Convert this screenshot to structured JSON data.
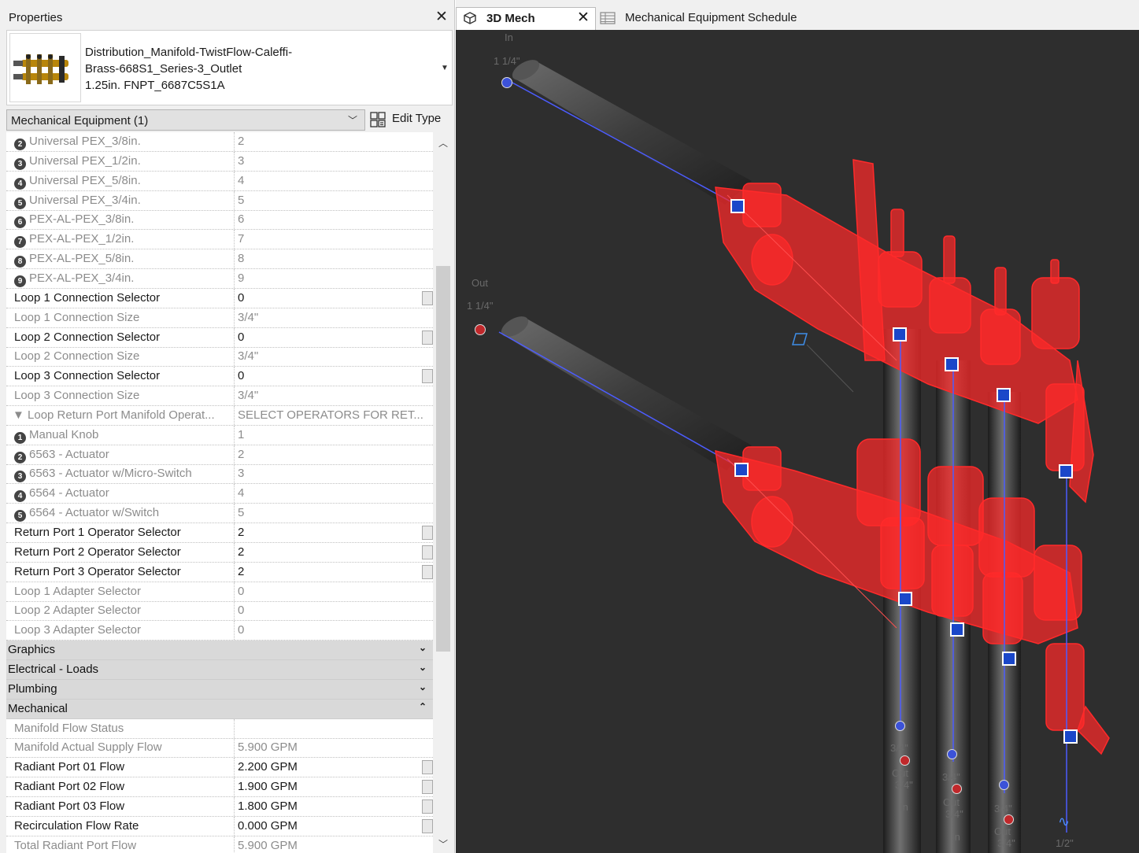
{
  "properties_panel": {
    "title": "Properties",
    "type_selector": {
      "name": "Distribution_Manifold-TwistFlow-Caleffi-\nBrass-668S1_Series-3_Outlet\n1.25in. FNPT_6687C5S1A",
      "thumbnail_icon": "manifold-thumbnail"
    },
    "filter": {
      "selected": "Mechanical Equipment (1)"
    },
    "edit_type_label": "Edit Type",
    "rows": [
      {
        "kind": "item",
        "num": "2",
        "name": "Universal PEX_3/8in.",
        "value": "2",
        "readonly": true
      },
      {
        "kind": "item",
        "num": "3",
        "name": "Universal PEX_1/2in.",
        "value": "3",
        "readonly": true
      },
      {
        "kind": "item",
        "num": "4",
        "name": "Universal PEX_5/8in.",
        "value": "4",
        "readonly": true
      },
      {
        "kind": "item",
        "num": "5",
        "name": "Universal PEX_3/4in.",
        "value": "5",
        "readonly": true
      },
      {
        "kind": "item",
        "num": "6",
        "name": "PEX-AL-PEX_3/8in.",
        "value": "6",
        "readonly": true
      },
      {
        "kind": "item",
        "num": "7",
        "name": "PEX-AL-PEX_1/2in.",
        "value": "7",
        "readonly": true
      },
      {
        "kind": "item",
        "num": "8",
        "name": "PEX-AL-PEX_5/8in.",
        "value": "8",
        "readonly": true
      },
      {
        "kind": "item",
        "num": "9",
        "name": "PEX-AL-PEX_3/4in.",
        "value": "9",
        "readonly": true
      },
      {
        "kind": "param",
        "name": "Loop 1 Connection Selector",
        "value": "0",
        "readonly": false
      },
      {
        "kind": "param",
        "name": "Loop 1 Connection Size",
        "value": "3/4\"",
        "readonly": true
      },
      {
        "kind": "param",
        "name": "Loop 2 Connection Selector",
        "value": "0",
        "readonly": false
      },
      {
        "kind": "param",
        "name": "Loop 2 Connection Size",
        "value": "3/4\"",
        "readonly": true
      },
      {
        "kind": "param",
        "name": "Loop 3 Connection Selector",
        "value": "0",
        "readonly": false
      },
      {
        "kind": "param",
        "name": "Loop 3 Connection Size",
        "value": "3/4\"",
        "readonly": true
      },
      {
        "kind": "subheader",
        "name": "▼ Loop Return Port Manifold Operat...",
        "value": "SELECT OPERATORS FOR RET...",
        "readonly": true
      },
      {
        "kind": "item",
        "num": "1",
        "name": "Manual Knob",
        "value": "1",
        "readonly": true
      },
      {
        "kind": "item",
        "num": "2",
        "name": "6563 - Actuator",
        "value": "2",
        "readonly": true
      },
      {
        "kind": "item",
        "num": "3",
        "name": "6563 - Actuator w/Micro-Switch",
        "value": "3",
        "readonly": true
      },
      {
        "kind": "item",
        "num": "4",
        "name": "6564 - Actuator",
        "value": "4",
        "readonly": true
      },
      {
        "kind": "item",
        "num": "5",
        "name": "6564 - Actuator w/Switch",
        "value": "5",
        "readonly": true
      },
      {
        "kind": "param",
        "name": "Return Port 1 Operator Selector",
        "value": "2",
        "readonly": false
      },
      {
        "kind": "param",
        "name": "Return Port 2 Operator Selector",
        "value": "2",
        "readonly": false
      },
      {
        "kind": "param",
        "name": "Return Port 3 Operator Selector",
        "value": "2",
        "readonly": false
      },
      {
        "kind": "param",
        "name": "Loop 1 Adapter Selector",
        "value": "0",
        "readonly": true
      },
      {
        "kind": "param",
        "name": "Loop 2 Adapter Selector",
        "value": "0",
        "readonly": true
      },
      {
        "kind": "param",
        "name": "Loop 3 Adapter Selector",
        "value": "0",
        "readonly": true
      },
      {
        "kind": "group",
        "name": "Graphics",
        "chevron": "expand"
      },
      {
        "kind": "group",
        "name": "Electrical - Loads",
        "chevron": "expand"
      },
      {
        "kind": "group",
        "name": "Plumbing",
        "chevron": "expand"
      },
      {
        "kind": "group",
        "name": "Mechanical",
        "chevron": "collapse"
      },
      {
        "kind": "param",
        "name": "Manifold Flow Status",
        "value": "",
        "readonly": true
      },
      {
        "kind": "param",
        "name": "Manifold Actual Supply Flow",
        "value": "5.900 GPM",
        "readonly": true
      },
      {
        "kind": "param",
        "name": "Radiant Port 01 Flow",
        "value": "2.200 GPM",
        "readonly": false
      },
      {
        "kind": "param",
        "name": "Radiant Port 02 Flow",
        "value": "1.900 GPM",
        "readonly": false
      },
      {
        "kind": "param",
        "name": "Radiant Port 03 Flow",
        "value": "1.800 GPM",
        "readonly": false
      },
      {
        "kind": "param",
        "name": "Recirculation Flow Rate",
        "value": "0.000 GPM",
        "readonly": false
      },
      {
        "kind": "param",
        "name": "Total Radiant Port Flow",
        "value": "5.900 GPM",
        "readonly": true
      }
    ]
  },
  "tabs": [
    {
      "label": "3D Mech",
      "icon": "3d-view-icon",
      "active": true
    },
    {
      "label": "Mechanical Equipment Schedule",
      "icon": "schedule-icon",
      "active": false
    }
  ],
  "viewport": {
    "background": "#2e2e2e",
    "selection_color": "#ff2a2a",
    "labels": {
      "supply_in": "In",
      "supply_size": "1 1/4\"",
      "return_out": "Out",
      "return_size": "1 1/4\"",
      "port_size_1": "3/4\"",
      "port_out_1": "Out",
      "port_size_1b": "3/4\"",
      "port_in_1": "In",
      "port_size_2": "3/4\"",
      "port_out_2": "Out",
      "port_size_2b": "3/4\"",
      "port_in_2": "In",
      "port_size_3": "3/4\"",
      "port_out_3": "Out",
      "port_size_3b": "3/4\"",
      "drain_size": "1/2\""
    }
  }
}
